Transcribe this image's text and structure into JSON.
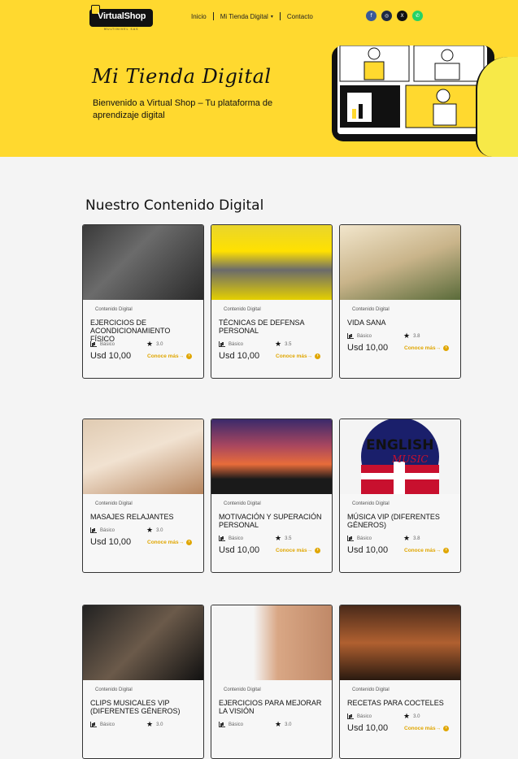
{
  "header": {
    "logo_text": "VirtualShop",
    "logo_sub": "MULTINIVEL SAS",
    "nav": [
      {
        "label": "Inicio"
      },
      {
        "label": "Mi Tienda Digital"
      },
      {
        "label": "Contacto"
      }
    ],
    "socials": [
      {
        "icon": "facebook-icon",
        "glyph": "f",
        "color": "#3b5998"
      },
      {
        "icon": "instagram-icon",
        "glyph": "◎",
        "color": "#1f2a44"
      },
      {
        "icon": "x-icon",
        "glyph": "𝕏",
        "color": "#111111"
      },
      {
        "icon": "whatsapp-icon",
        "glyph": "✆",
        "color": "#25d366"
      }
    ]
  },
  "hero": {
    "title": "Mi Tienda Digital",
    "subtitle": "Bienvenido a Virtual Shop – Tu plataforma de aprendizaje digital",
    "accent": "#ffd92f"
  },
  "section": {
    "title": "Nuestro Contenido Digital"
  },
  "cards": [
    {
      "category": "Contenido Digital",
      "title": "EJERCICIOS DE ACONDICIONAMIENTO FÍSICO",
      "level": "Básico",
      "rating": "3.0",
      "price": "Usd 10,00",
      "more": "Conoce más→",
      "image": "fitness-photo"
    },
    {
      "category": "Contenido Digital",
      "title": "TÉCNICAS DE DEFENSA PERSONAL",
      "level": "Básico",
      "rating": "3.5",
      "price": "Usd 10,00",
      "more": "Conoce más→",
      "image": "self-defense-photo"
    },
    {
      "category": "Contenido Digital",
      "title": "VIDA SANA",
      "level": "Básico",
      "rating": "3.8",
      "price": "Usd 10,00",
      "more": "Conoce más→",
      "image": "herbs-photo"
    },
    {
      "category": "Contenido Digital",
      "title": "MASAJES RELAJANTES",
      "level": "Básico",
      "rating": "3.0",
      "price": "Usd 10,00",
      "more": "Conoce más→",
      "image": "massage-photo"
    },
    {
      "category": "Contenido Digital",
      "title": "MOTIVACIÓN Y SUPERACIÓN PERSONAL",
      "level": "Básico",
      "rating": "3.5",
      "price": "Usd 10,00",
      "more": "Conoce más→",
      "image": "sunset-photo"
    },
    {
      "category": "Contenido Digital",
      "title": "MÚSICA VIP (DIFERENTES GÉNEROS)",
      "level": "Básico",
      "rating": "3.8",
      "price": "Usd 10,00",
      "more": "Conoce más→",
      "image": "english-music-photo",
      "image_text_1": "ENGLISH",
      "image_text_2": "MUSIC"
    },
    {
      "category": "Contenido Digital",
      "title": "CLIPS MUSICALES VIP (DIFERENTES GÉNEROS)",
      "level": "Básico",
      "rating": "3.0",
      "price": "",
      "more": "",
      "image": "clips-photo"
    },
    {
      "category": "Contenido Digital",
      "title": "EJERCICIOS PARA MEJORAR LA VISIÓN",
      "level": "Básico",
      "rating": "3.0",
      "price": "",
      "more": "",
      "image": "vision-photo"
    },
    {
      "category": "Contenido Digital",
      "title": "RECETAS PARA COCTELES",
      "level": "Básico",
      "rating": "3.0",
      "price": "Usd 10,00",
      "more": "Conoce más→",
      "image": "cocktails-photo"
    }
  ]
}
